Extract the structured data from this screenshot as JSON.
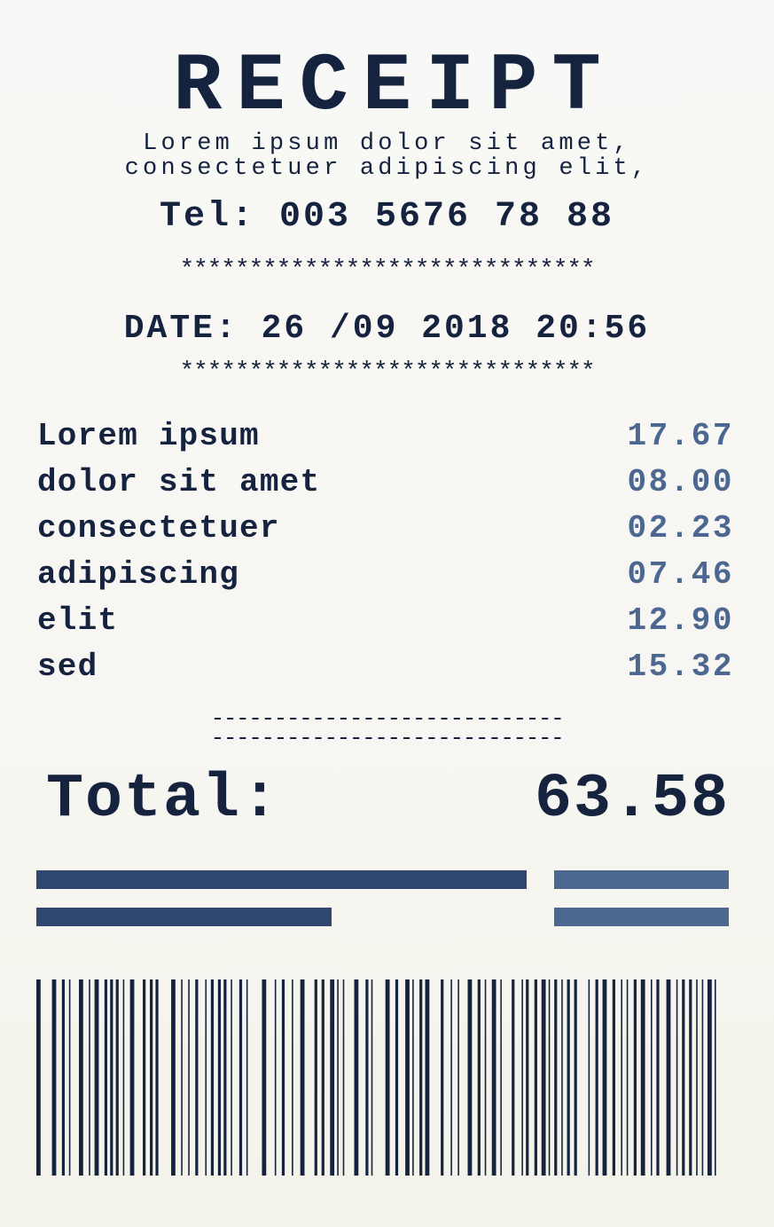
{
  "header": {
    "title": "RECEIPT",
    "subtitle_line1": "Lorem ipsum dolor sit amet,",
    "subtitle_line2": "consectetuer adipiscing elit,",
    "tel": "Tel: 003 5676 78 88"
  },
  "separators": {
    "stars": "******************************",
    "dashes": "----------------------------"
  },
  "date_line": "DATE: 26 /09 2018 20:56",
  "items": [
    {
      "name": "Lorem ipsum",
      "price": "17.67"
    },
    {
      "name": "dolor sit amet",
      "price": "08.00"
    },
    {
      "name": "consectetuer",
      "price": "02.23"
    },
    {
      "name": "adipiscing",
      "price": "07.46"
    },
    {
      "name": "elit",
      "price": "12.90"
    },
    {
      "name": "sed",
      "price": "15.32"
    }
  ],
  "total": {
    "label": "Total:",
    "value": "63.58"
  },
  "colors": {
    "ink": "#16233f",
    "price": "#4d6890",
    "bar_dark": "#2f4670",
    "bar_light": "#4d6890"
  },
  "barcode": {
    "pattern": [
      3,
      8,
      3,
      4,
      2,
      3,
      1,
      6,
      3,
      4,
      1,
      3,
      3,
      4,
      2,
      2,
      2,
      2,
      2,
      3,
      1,
      4,
      3,
      6,
      2,
      3,
      2,
      2,
      2,
      9,
      3,
      4,
      1,
      4,
      1,
      4,
      2,
      5,
      1,
      3,
      2,
      3,
      2,
      2,
      2,
      3,
      1,
      5,
      2,
      3,
      1,
      10,
      3,
      6,
      1,
      4,
      2,
      5,
      1,
      5,
      3,
      7,
      2,
      3,
      2,
      4,
      3,
      2,
      1,
      3,
      1,
      7,
      3,
      5,
      2,
      2,
      1,
      9,
      3,
      4,
      2,
      5,
      3,
      2,
      1,
      4,
      2,
      2,
      3,
      8,
      2,
      5,
      1,
      4,
      1,
      6,
      3,
      4,
      2,
      3,
      1,
      4,
      3,
      3,
      1,
      7,
      2,
      5,
      1,
      2,
      2,
      4,
      2,
      3,
      3,
      2,
      1,
      3,
      2,
      3,
      1,
      3,
      2,
      3,
      2,
      8,
      1,
      4,
      2,
      3,
      3,
      4,
      2,
      4,
      1,
      3,
      1,
      4,
      2,
      3,
      3,
      4,
      1,
      3,
      2,
      5,
      3,
      4,
      1,
      3,
      2,
      3,
      2,
      3,
      1,
      3,
      1,
      3,
      3,
      2,
      1,
      9
    ],
    "module_width": 2.72
  }
}
